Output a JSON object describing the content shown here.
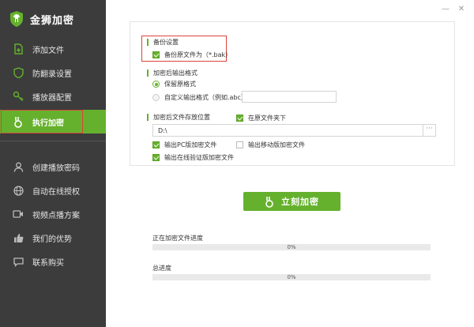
{
  "app": {
    "title": "金狮加密"
  },
  "window": {
    "minimize_glyph": "—",
    "close_glyph": "✕"
  },
  "sidebar": {
    "items": [
      {
        "label": "添加文件",
        "icon": "add-file-icon"
      },
      {
        "label": "防翻录设置",
        "icon": "shield-icon"
      },
      {
        "label": "播放器配置",
        "icon": "key-icon"
      },
      {
        "label": "执行加密",
        "icon": "lock-ring-icon",
        "active": true
      },
      {
        "label": "创建播放密码",
        "icon": "user-icon"
      },
      {
        "label": "自动在线授权",
        "icon": "globe-icon"
      },
      {
        "label": "视频点播方案",
        "icon": "video-icon"
      },
      {
        "label": "我们的优势",
        "icon": "thumbs-up-icon"
      },
      {
        "label": "联系购买",
        "icon": "chat-icon"
      }
    ]
  },
  "backup": {
    "section_label": "备份设置",
    "backup_original_label": "备份原文件为（*.bak）",
    "backup_original_checked": true
  },
  "output_format": {
    "section_label": "加密后输出格式",
    "keep_original_label": "保留原格式",
    "custom_label": "自定义输出格式（例如.abc）",
    "custom_value": "",
    "selected": "keep_original"
  },
  "output_location": {
    "section_label": "加密后文件存放位置",
    "same_folder_label": "在原文件夹下",
    "same_folder_checked": true,
    "path_value": "D:\\",
    "browse_label": "···",
    "pc_label": "输出PC版加密文件",
    "pc_checked": true,
    "mobile_label": "输出移动版加密文件",
    "mobile_checked": false,
    "online_label": "输出在线验证版加密文件",
    "online_checked": true
  },
  "action": {
    "encrypt_button_label": "立刻加密"
  },
  "progress": {
    "current_label": "正在加密文件进度",
    "current_value": 0,
    "current_text": "0%",
    "total_label": "总进度",
    "total_value": 0,
    "total_text": "0%"
  },
  "colors": {
    "accent": "#65b12d",
    "sidebar_bg": "#3c3c3c",
    "highlight_border": "#d9453a"
  }
}
